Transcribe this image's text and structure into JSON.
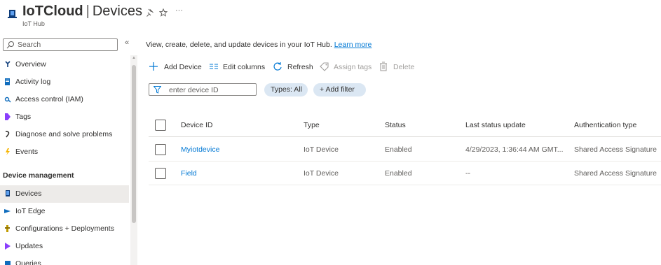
{
  "header": {
    "title_bold": "IoTCloud",
    "separator": "|",
    "title_page": "Devices",
    "subtitle": "IoT Hub",
    "pin_icon": "pin-icon",
    "star_icon": "star-icon",
    "more_label": "···"
  },
  "sidebar": {
    "search_placeholder": "Search",
    "collapse_label": "«",
    "items": [
      {
        "label": "Overview",
        "icon": "overview-icon"
      },
      {
        "label": "Activity log",
        "icon": "activity-log-icon"
      },
      {
        "label": "Access control (IAM)",
        "icon": "access-control-icon"
      },
      {
        "label": "Tags",
        "icon": "tag-icon"
      },
      {
        "label": "Diagnose and solve problems",
        "icon": "diagnose-icon"
      },
      {
        "label": "Events",
        "icon": "events-icon"
      }
    ],
    "section_header": "Device management",
    "section_items": [
      {
        "label": "Devices",
        "icon": "devices-icon",
        "active": true
      },
      {
        "label": "IoT Edge",
        "icon": "iot-edge-icon"
      },
      {
        "label": "Configurations + Deployments",
        "icon": "configurations-icon"
      },
      {
        "label": "Updates",
        "icon": "updates-icon"
      },
      {
        "label": "Queries",
        "icon": "queries-icon"
      }
    ]
  },
  "main": {
    "description": "View, create, delete, and update devices in your IoT Hub.",
    "learn_more": "Learn more",
    "toolbar": {
      "add_device": "Add Device",
      "edit_columns": "Edit columns",
      "refresh": "Refresh",
      "assign_tags": "Assign tags",
      "delete": "Delete"
    },
    "filter_placeholder": "enter device ID",
    "types_pill": "Types: All",
    "add_filter": "+ Add filter",
    "table": {
      "headers": [
        "Device ID",
        "Type",
        "Status",
        "Last status update",
        "Authentication type"
      ],
      "rows": [
        [
          "Myiotdevice",
          "IoT Device",
          "Enabled",
          "4/29/2023, 1:36:44 AM GMT...",
          "Shared Access Signature"
        ],
        [
          "Field",
          "IoT Device",
          "Enabled",
          "--",
          "Shared Access Signature"
        ]
      ]
    }
  },
  "colors": {
    "accent": "#0078d4",
    "active_nav": "#edebe9",
    "pill_bg": "#dbe7f3"
  }
}
